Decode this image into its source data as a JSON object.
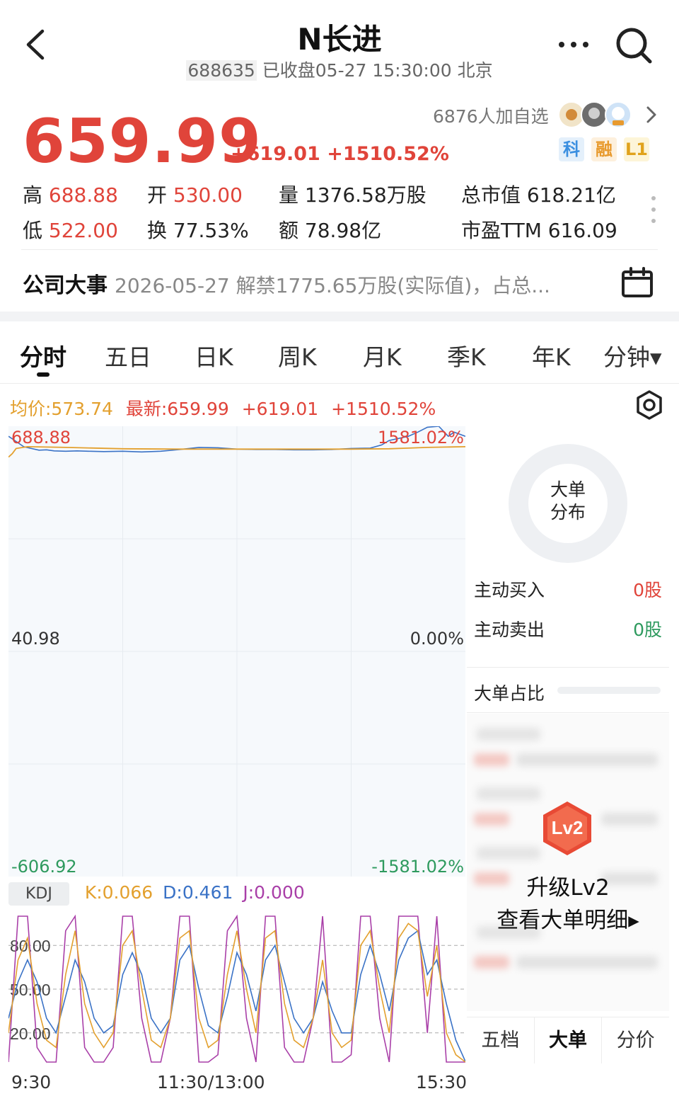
{
  "header": {
    "title": "N长进",
    "code": "688635",
    "status": "已收盘05-27 15:30:00 北京"
  },
  "quote": {
    "price": "659.99",
    "change": "+619.01",
    "change_pct": "+1510.52%",
    "watchlist_count": "6876人加自选",
    "tags": [
      "科",
      "融",
      "L1"
    ],
    "stats": {
      "high_label": "高",
      "high": "688.88",
      "low_label": "低",
      "low": "522.00",
      "open_label": "开",
      "open": "530.00",
      "turnover_label": "换",
      "turnover": "77.53%",
      "volume_label": "量",
      "volume": "1376.58万股",
      "amount_label": "额",
      "amount": "78.98亿",
      "mcap_label": "总市值",
      "mcap": "618.21亿",
      "pe_label": "市盈TTM",
      "pe": "616.09"
    }
  },
  "event": {
    "label": "公司大事",
    "text": "2026-05-27 解禁1775.65万股(实际值)，占总..."
  },
  "tabs": [
    "分时",
    "五日",
    "日K",
    "周K",
    "月K",
    "季K",
    "年K",
    "分钟▾"
  ],
  "infoline": {
    "avg": "均价:573.74",
    "latest": "最新:659.99",
    "change": "+619.01",
    "change_pct": "+1510.52%"
  },
  "chart_data": [
    {
      "type": "line",
      "title": "",
      "xlabel": "",
      "ylabel": "",
      "y_tick_labels_left": [
        "688.88",
        "40.98",
        "-606.92"
      ],
      "y_tick_labels_right": [
        "1581.02%",
        "0.00%",
        "-1581.02%"
      ],
      "ylim": [
        -606.92,
        688.88
      ],
      "x_tick_labels": [
        "9:30",
        "11:30/13:00",
        "15:30"
      ],
      "series": [
        {
          "name": "",
          "color": "#3a72c6",
          "x": [
            0,
            4,
            8,
            12,
            16,
            20,
            24,
            30,
            36,
            42,
            50,
            60,
            70,
            80,
            90,
            100,
            110,
            120,
            130,
            140,
            150,
            160,
            170,
            180,
            190,
            196,
            200,
            210,
            215,
            220,
            226,
            231,
            234,
            240
          ],
          "values": [
            660,
            645,
            630,
            625,
            620,
            621,
            618,
            617,
            618,
            617,
            616,
            617,
            615,
            617,
            622,
            628,
            627,
            623,
            622,
            622,
            621,
            621,
            622,
            625,
            626,
            635,
            648,
            660,
            672,
            686,
            688.88,
            660,
            672,
            659.99
          ]
        },
        {
          "name": "",
          "color": "#e3a02e",
          "x": [
            0,
            2,
            4,
            10,
            30,
            60,
            90,
            120,
            150,
            180,
            200,
            210,
            220,
            230,
            240
          ],
          "values": [
            600,
            610,
            625,
            630,
            628,
            624,
            623,
            623,
            623,
            623,
            624,
            626,
            628,
            629,
            630
          ]
        }
      ]
    },
    {
      "type": "line",
      "title": "",
      "yticks": [
        "80.00",
        "50.00",
        "20.00"
      ],
      "ylim": [
        0,
        100
      ],
      "series": [
        {
          "name": "K",
          "color": "#e3a02e",
          "values": [
            20,
            70,
            85,
            40,
            15,
            10,
            60,
            90,
            40,
            20,
            10,
            20,
            80,
            90,
            50,
            15,
            10,
            30,
            85,
            90,
            30,
            10,
            15,
            60,
            90,
            50,
            20,
            85,
            90,
            40,
            15,
            10,
            30,
            70,
            20,
            10,
            15,
            80,
            90,
            50,
            20,
            85,
            95,
            90,
            45,
            80,
            20,
            5,
            0.066
          ]
        },
        {
          "name": "D",
          "color": "#3a72c6",
          "values": [
            30,
            55,
            70,
            55,
            30,
            20,
            45,
            70,
            55,
            30,
            20,
            25,
            60,
            75,
            60,
            30,
            20,
            30,
            70,
            80,
            50,
            25,
            20,
            45,
            75,
            60,
            35,
            70,
            80,
            55,
            30,
            20,
            30,
            55,
            35,
            20,
            20,
            60,
            80,
            60,
            35,
            70,
            85,
            90,
            60,
            70,
            40,
            15,
            0.461
          ]
        },
        {
          "name": "J",
          "color": "#a93fa8",
          "values": [
            0,
            100,
            100,
            10,
            0,
            0,
            90,
            100,
            10,
            0,
            0,
            10,
            100,
            100,
            30,
            0,
            0,
            30,
            100,
            100,
            0,
            0,
            5,
            90,
            100,
            30,
            0,
            100,
            100,
            10,
            0,
            0,
            30,
            100,
            0,
            0,
            5,
            100,
            100,
            30,
            0,
            100,
            100,
            100,
            20,
            100,
            0,
            0,
            0.0
          ]
        }
      ]
    }
  ],
  "kdj": {
    "tag": "KDJ",
    "k": "K:0.066",
    "d": "D:0.461",
    "j": "J:0.000"
  },
  "right_panel": {
    "donut_label_1": "大单",
    "donut_label_2": "分布",
    "buy_label": "主动买入",
    "buy_value": "0股",
    "sell_label": "主动卖出",
    "sell_value": "0股",
    "ratio_label": "大单占比",
    "upgrade_badge": "Lv2",
    "upgrade_title": "升级Lv2",
    "upgrade_link": "查看大单明细▸",
    "bottom_tabs": [
      "五档",
      "大单",
      "分价"
    ]
  },
  "colors": {
    "up": "#e0443a",
    "down": "#2e9a5e",
    "avg_line": "#e3a02e",
    "price_line": "#3a72c6",
    "j_line": "#a93fa8"
  }
}
